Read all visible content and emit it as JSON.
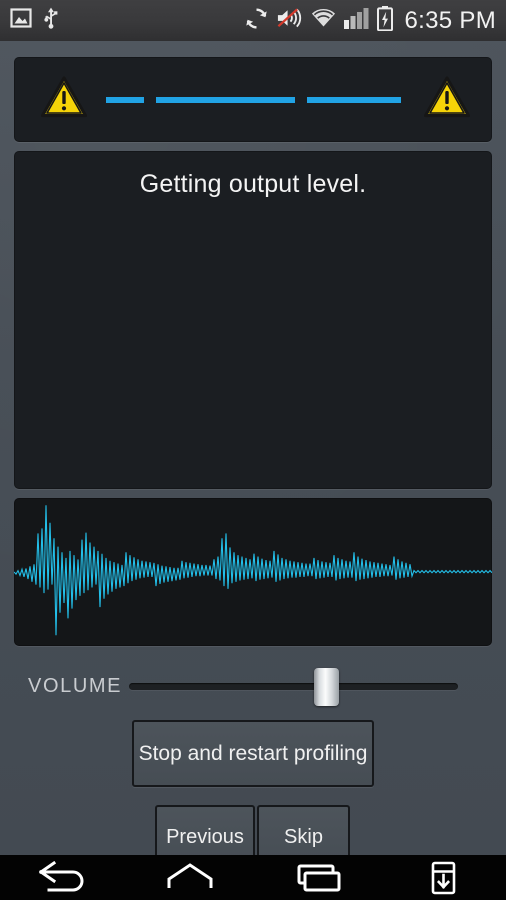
{
  "status_bar": {
    "left_icons": [
      {
        "name": "gallery-icon",
        "label": "Gallery"
      },
      {
        "name": "usb-icon",
        "label": "USB connected"
      }
    ],
    "right_icons": [
      {
        "name": "sync-icon",
        "label": "Sync"
      },
      {
        "name": "volume-muted-icon",
        "label": "Sound muted"
      },
      {
        "name": "wifi-icon",
        "label": "Wi-Fi"
      },
      {
        "name": "cellular-signal-icon",
        "label": "Signal"
      },
      {
        "name": "battery-charging-icon",
        "label": "Battery charging"
      }
    ],
    "clock": "6:35 PM",
    "background": "#39393b",
    "text_color": "#f2f2f2"
  },
  "progress": {
    "left_warning_icon": "warning-triangle-icon",
    "right_warning_icon": "warning-triangle-icon",
    "segment_color": "#21a3e5",
    "warning_fill": "#f5d308",
    "warning_stroke": "#161616",
    "segments": [
      {
        "left_pct": 0,
        "width_pct": 13
      },
      {
        "left_pct": 17,
        "width_pct": 47
      },
      {
        "left_pct": 68,
        "width_pct": 32
      }
    ]
  },
  "message": {
    "text": "Getting output level."
  },
  "waveform": {
    "line_color": "#23bfe9",
    "background": "#141618",
    "samples": [
      0.0,
      0.03,
      0.02,
      0.05,
      0.04,
      0.07,
      0.05,
      0.1,
      0.08,
      0.14,
      0.11,
      0.18,
      0.55,
      0.22,
      0.62,
      0.3,
      0.95,
      0.25,
      0.7,
      0.18,
      0.48,
      0.9,
      0.36,
      0.58,
      0.28,
      0.44,
      0.2,
      0.66,
      0.3,
      0.52,
      0.24,
      0.4,
      0.18,
      0.34,
      0.46,
      0.3,
      0.56,
      0.26,
      0.42,
      0.22,
      0.36,
      0.18,
      0.3,
      0.5,
      0.26,
      0.38,
      0.2,
      0.32,
      0.16,
      0.28,
      0.14,
      0.24,
      0.12,
      0.22,
      0.1,
      0.2,
      0.28,
      0.16,
      0.24,
      0.13,
      0.21,
      0.11,
      0.18,
      0.09,
      0.16,
      0.08,
      0.15,
      0.07,
      0.14,
      0.07,
      0.13,
      0.2,
      0.11,
      0.17,
      0.09,
      0.15,
      0.08,
      0.14,
      0.07,
      0.13,
      0.06,
      0.12,
      0.06,
      0.11,
      0.16,
      0.09,
      0.14,
      0.08,
      0.13,
      0.07,
      0.12,
      0.06,
      0.11,
      0.06,
      0.1,
      0.05,
      0.1,
      0.05,
      0.09,
      0.05,
      0.18,
      0.1,
      0.22,
      0.12,
      0.48,
      0.2,
      0.55,
      0.24,
      0.35,
      0.16,
      0.28,
      0.14,
      0.24,
      0.12,
      0.22,
      0.11,
      0.2,
      0.1,
      0.18,
      0.09,
      0.26,
      0.13,
      0.22,
      0.11,
      0.19,
      0.1,
      0.17,
      0.09,
      0.16,
      0.08,
      0.3,
      0.14,
      0.25,
      0.12,
      0.2,
      0.1,
      0.18,
      0.09,
      0.16,
      0.08,
      0.15,
      0.08,
      0.14,
      0.07,
      0.13,
      0.07,
      0.12,
      0.06,
      0.12,
      0.06,
      0.2,
      0.1,
      0.17,
      0.09,
      0.15,
      0.08,
      0.14,
      0.07,
      0.13,
      0.07,
      0.24,
      0.12,
      0.2,
      0.1,
      0.18,
      0.09,
      0.16,
      0.08,
      0.15,
      0.08,
      0.28,
      0.13,
      0.22,
      0.11,
      0.19,
      0.1,
      0.17,
      0.09,
      0.15,
      0.08,
      0.14,
      0.07,
      0.13,
      0.07,
      0.12,
      0.06,
      0.11,
      0.06,
      0.1,
      0.05,
      0.22,
      0.11,
      0.18,
      0.09,
      0.15,
      0.08,
      0.13,
      0.07,
      0.11,
      0.06,
      0.02,
      0.01,
      0.02,
      0.01,
      0.02,
      0.01,
      0.02,
      0.01,
      0.02,
      0.01,
      0.02,
      0.01,
      0.02,
      0.01,
      0.02,
      0.01,
      0.02,
      0.01,
      0.02,
      0.01,
      0.02,
      0.01,
      0.02,
      0.01,
      0.02,
      0.01,
      0.02,
      0.01,
      0.02,
      0.01,
      0.02,
      0.01,
      0.02,
      0.01,
      0.02,
      0.01,
      0.02,
      0.01,
      0.02,
      0.01
    ]
  },
  "volume": {
    "label": "VOLUME",
    "value_pct": 60,
    "min": 0,
    "max": 100
  },
  "buttons": {
    "stop_restart": "Stop and restart profiling",
    "previous": "Previous",
    "skip": "Skip"
  },
  "nav_bar": {
    "items": [
      {
        "name": "back-icon",
        "label": "Back"
      },
      {
        "name": "home-icon",
        "label": "Home"
      },
      {
        "name": "recents-icon",
        "label": "Recent apps"
      },
      {
        "name": "notification-panel-icon",
        "label": "Notifications"
      }
    ],
    "background": "#030303",
    "icon_color": "#ffffff"
  }
}
